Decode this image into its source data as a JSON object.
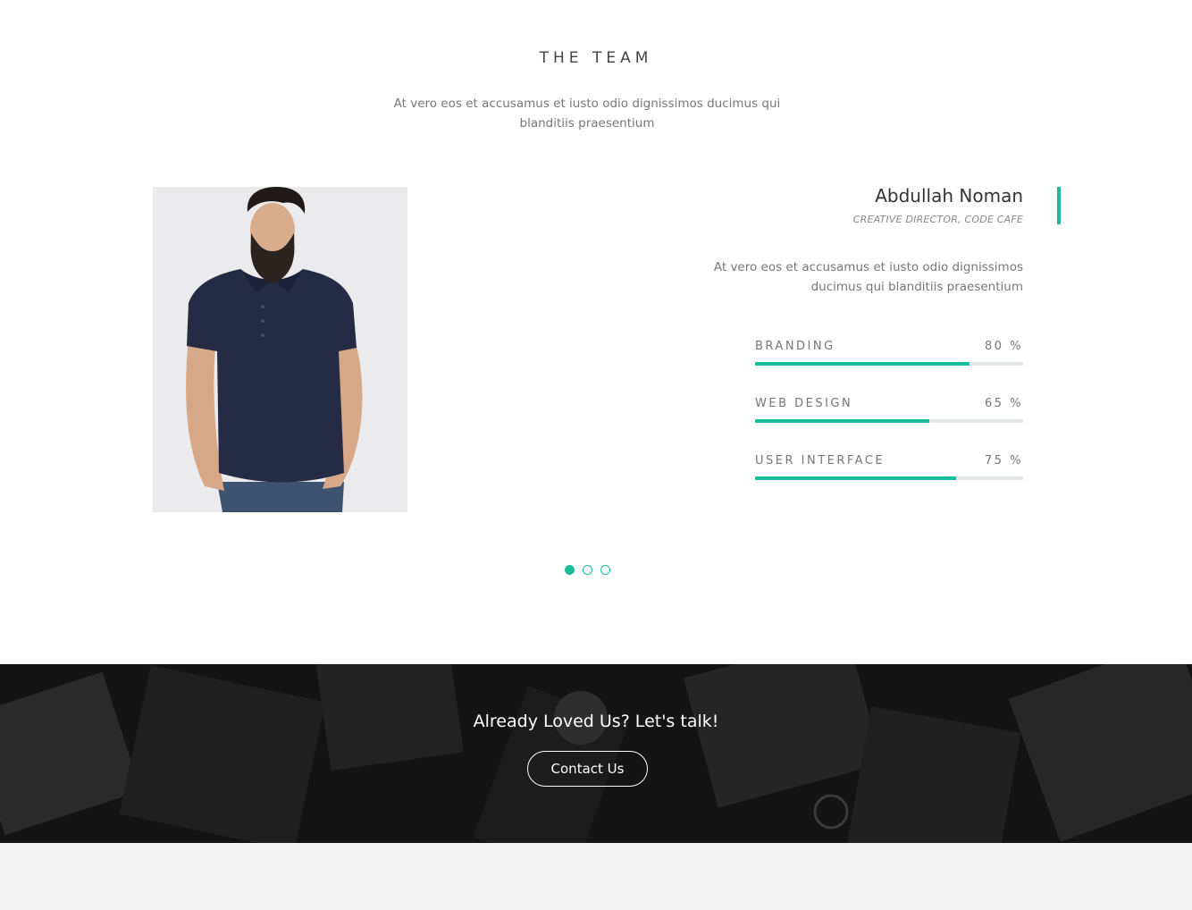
{
  "team": {
    "title": "THE TEAM",
    "subtitle": "At vero eos et accusamus et iusto odio dignissimos ducimus qui blanditiis praesentium",
    "member": {
      "name": "Abdullah Noman",
      "role": "CREATIVE DIRECTOR, CODE CAFE",
      "bio": "At vero eos et accusamus et iusto odio dignissimos ducimus qui blanditiis praesentium",
      "skills": [
        {
          "label": "BRANDING",
          "value_text": "80 %",
          "percent": 80
        },
        {
          "label": "WEB DESIGN",
          "value_text": "65 %",
          "percent": 65
        },
        {
          "label": "USER INTERFACE",
          "value_text": "75 %",
          "percent": 75
        }
      ]
    },
    "pager": {
      "count": 3,
      "active_index": 0
    }
  },
  "cta": {
    "title": "Already Loved Us? Let's talk!",
    "button_label": "Contact Us"
  },
  "colors": {
    "accent": "#1abc9c",
    "track": "#e3e6ea",
    "cta_background": "#141414",
    "footer": "#f2f2f2"
  }
}
